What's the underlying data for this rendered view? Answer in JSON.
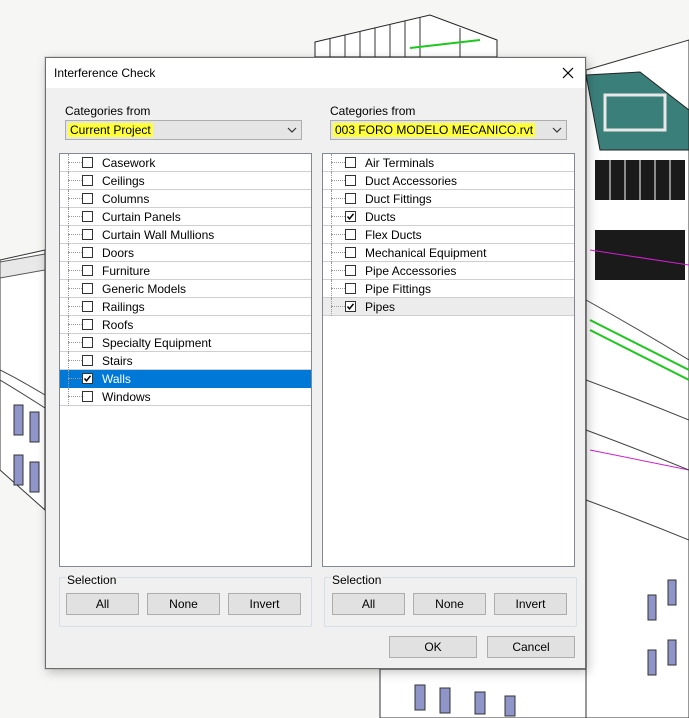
{
  "dialog": {
    "title": "Interference Check",
    "ok_label": "OK",
    "cancel_label": "Cancel"
  },
  "left": {
    "categories_label": "Categories from",
    "source": "Current Project",
    "items": [
      {
        "label": "Casework",
        "checked": false
      },
      {
        "label": "Ceilings",
        "checked": false
      },
      {
        "label": "Columns",
        "checked": false
      },
      {
        "label": "Curtain Panels",
        "checked": false
      },
      {
        "label": "Curtain Wall Mullions",
        "checked": false
      },
      {
        "label": "Doors",
        "checked": false
      },
      {
        "label": "Furniture",
        "checked": false
      },
      {
        "label": "Generic Models",
        "checked": false
      },
      {
        "label": "Railings",
        "checked": false
      },
      {
        "label": "Roofs",
        "checked": false
      },
      {
        "label": "Specialty Equipment",
        "checked": false
      },
      {
        "label": "Stairs",
        "checked": false
      },
      {
        "label": "Walls",
        "checked": true,
        "selected": true
      },
      {
        "label": "Windows",
        "checked": false
      }
    ],
    "selection_label": "Selection",
    "all_label": "All",
    "none_label": "None",
    "invert_label": "Invert"
  },
  "right": {
    "categories_label": "Categories from",
    "source": "003 FORO MODELO MECANICO.rvt",
    "items": [
      {
        "label": "Air Terminals",
        "checked": false
      },
      {
        "label": "Duct Accessories",
        "checked": false
      },
      {
        "label": "Duct Fittings",
        "checked": false
      },
      {
        "label": "Ducts",
        "checked": true
      },
      {
        "label": "Flex Ducts",
        "checked": false
      },
      {
        "label": "Mechanical Equipment",
        "checked": false
      },
      {
        "label": "Pipe Accessories",
        "checked": false
      },
      {
        "label": "Pipe Fittings",
        "checked": false
      },
      {
        "label": "Pipes",
        "checked": true,
        "hot": true
      }
    ],
    "selection_label": "Selection",
    "all_label": "All",
    "none_label": "None",
    "invert_label": "Invert"
  },
  "colors": {
    "highlight": "#ffff3a",
    "selected_row": "#0078d7"
  },
  "icons": [
    "close-icon",
    "chevron-down-icon",
    "checkmark-icon"
  ]
}
